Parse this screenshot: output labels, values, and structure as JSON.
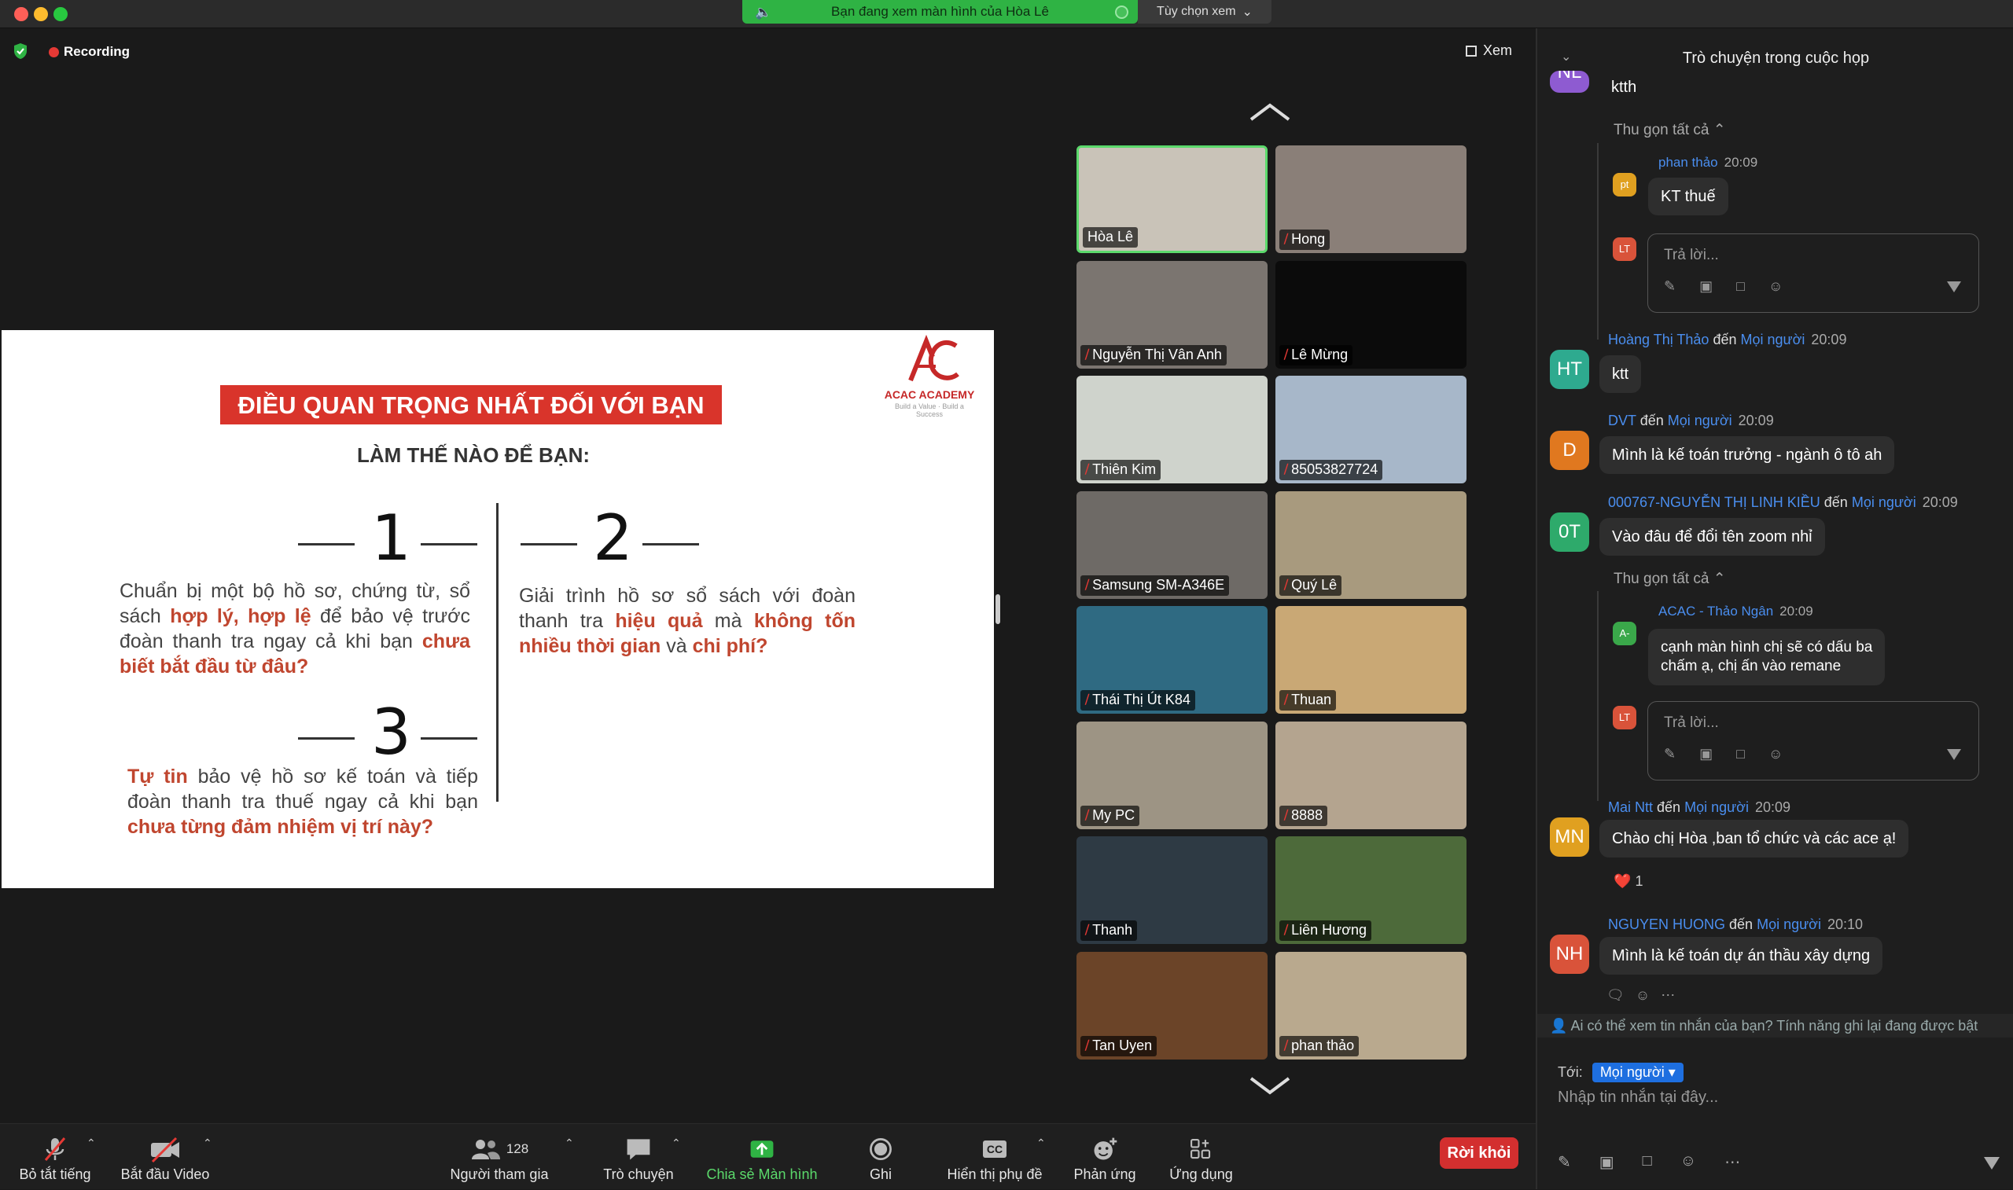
{
  "window": {
    "share_banner": "Bạn đang xem màn hình của Hòa Lê",
    "view_options": "Tùy chọn xem"
  },
  "meeting": {
    "recording_label": "Recording",
    "view_label": "Xem",
    "participant_count": "128"
  },
  "slide": {
    "banner": "ĐIỀU QUAN TRỌNG NHẤT ĐỐI VỚI BẠN",
    "subtitle": "LÀM THẾ NÀO ĐỂ BẠN:",
    "logo_text": "ACAC ACADEMY",
    "logo_tagline": "Build a Value · Build a Success",
    "points": [
      {
        "number": "1"
      },
      {
        "number": "2"
      },
      {
        "number": "3"
      }
    ],
    "p1": {
      "a": "Chuẩn bị một bộ hồ sơ, chứng từ, sổ sách ",
      "b": "hợp lý, hợp lệ",
      "c": " để bảo vệ trước đoàn thanh tra ngay cả khi bạn ",
      "d": "chưa biết bắt đầu từ đâu?"
    },
    "p2": {
      "a": "Giải trình hồ sơ sổ sách với đoàn thanh tra ",
      "b": "hiệu quả",
      "c": " mà ",
      "d": "không tốn nhiều thời gian",
      "e": " và ",
      "f": "chi phí?"
    },
    "p3": {
      "a": "Tự tin",
      "b": " bảo vệ hồ sơ kế toán và tiếp đoàn thanh tra thuế ngay cả khi bạn ",
      "c": "chưa từng đảm nhiệm vị trí này?"
    }
  },
  "gallery": [
    {
      "name": "Hòa Lê",
      "muted": false,
      "active": true,
      "bg": "#c9c3b8"
    },
    {
      "name": "Hong",
      "muted": true,
      "active": false,
      "bg": "#8a7f78"
    },
    {
      "name": "Nguyễn Thị Vân Anh",
      "muted": true,
      "active": false,
      "bg": "#7b7570"
    },
    {
      "name": "Lê Mừng",
      "muted": true,
      "active": false,
      "bg": "#0b0b0b"
    },
    {
      "name": "Thiên Kim",
      "muted": true,
      "active": false,
      "bg": "#cfd3cc"
    },
    {
      "name": "85053827724",
      "muted": true,
      "active": false,
      "bg": "#a7b7c9"
    },
    {
      "name": "Samsung SM-A346E",
      "muted": true,
      "active": false,
      "bg": "#6e6a66"
    },
    {
      "name": "Quý Lê",
      "muted": true,
      "active": false,
      "bg": "#a89a7e"
    },
    {
      "name": "Thái Thị Út K84",
      "muted": true,
      "active": false,
      "bg": "#2f6a82"
    },
    {
      "name": "Thuan",
      "muted": true,
      "active": false,
      "bg": "#c9a875"
    },
    {
      "name": "My PC",
      "muted": true,
      "active": false,
      "bg": "#9d9484"
    },
    {
      "name": "8888",
      "muted": true,
      "active": false,
      "bg": "#b4a48f"
    },
    {
      "name": "Thanh",
      "muted": true,
      "active": false,
      "bg": "#2e3a44"
    },
    {
      "name": "Liên Hương",
      "muted": true,
      "active": false,
      "bg": "#4d6a3a"
    },
    {
      "name": "Tan Uyen",
      "muted": true,
      "active": false,
      "bg": "#6b4428"
    },
    {
      "name": "phan thảo",
      "muted": true,
      "active": false,
      "bg": "#b9a98e"
    }
  ],
  "toolbar": {
    "mute": "Bỏ tắt tiếng",
    "video": "Bắt đầu Video",
    "participants": "Người tham gia",
    "chat": "Trò chuyện",
    "share": "Chia sẻ Màn hình",
    "record": "Ghi",
    "captions": "Hiển thị phụ đề",
    "reactions": "Phản ứng",
    "apps": "Ứng dụng",
    "leave": "Rời khỏi",
    "cc_text": "CC"
  },
  "chat": {
    "title": "Trò chuyện trong cuộc họp",
    "collapse_all": "Thu gọn tất cả",
    "reply_placeholder": "Trả lời...",
    "to_everyone": "đến",
    "everyone": "Mọi người",
    "messages": [
      {
        "initials": "NL",
        "text": "ktth",
        "avatar_color": "#8e5bd1"
      },
      {
        "initials": "pt",
        "sender": "phan thảo",
        "time": "20:09",
        "text": "KT thuế",
        "avatar_color": "#e0a020"
      },
      {
        "initials": "HT",
        "sender": "Hoàng Thị Thảo",
        "time": "20:09",
        "text": "ktt",
        "avatar_color": "#2eaa8f"
      },
      {
        "initials": "D",
        "sender": "DVT",
        "time": "20:09",
        "text": "Mình là kế toán trưởng - ngành ô tô ah",
        "avatar_color": "#e0781f"
      },
      {
        "initials": "0T",
        "sender": "000767-NGUYỄN THỊ LINH KIỀU",
        "time": "20:09",
        "text": "Vào đâu để đổi tên zoom nhỉ",
        "avatar_color": "#2eaa6b"
      },
      {
        "initials": "A-",
        "sender": "ACAC - Thảo Ngân",
        "time": "20:09",
        "text1": "cạnh màn hình chị sẽ có dấu ba",
        "text2": "chấm ạ, chị ấn vào remane",
        "avatar_color": "#3aa84a"
      },
      {
        "initials": "MN",
        "sender": "Mai Ntt",
        "time": "20:09",
        "text": "Chào chị Hòa ,ban tổ chức và các ace ạ!",
        "avatar_color": "#e0a020",
        "reaction": "❤️",
        "reaction_count": "1"
      },
      {
        "initials": "NH",
        "sender": "NGUYEN HUONG",
        "time": "20:10",
        "text": "Mình là kế toán dự án thầu xây dựng",
        "avatar_color": "#d9533a"
      }
    ],
    "reply_avatar": "LT",
    "reply_avatar_color": "#d9533a",
    "privacy": "Ai có thể xem tin nhắn của bạn? Tính năng ghi lại đang được bật",
    "to_label": "Tới:",
    "to_value": "Mọi người",
    "input_placeholder": "Nhập tin nhắn tại đây..."
  }
}
